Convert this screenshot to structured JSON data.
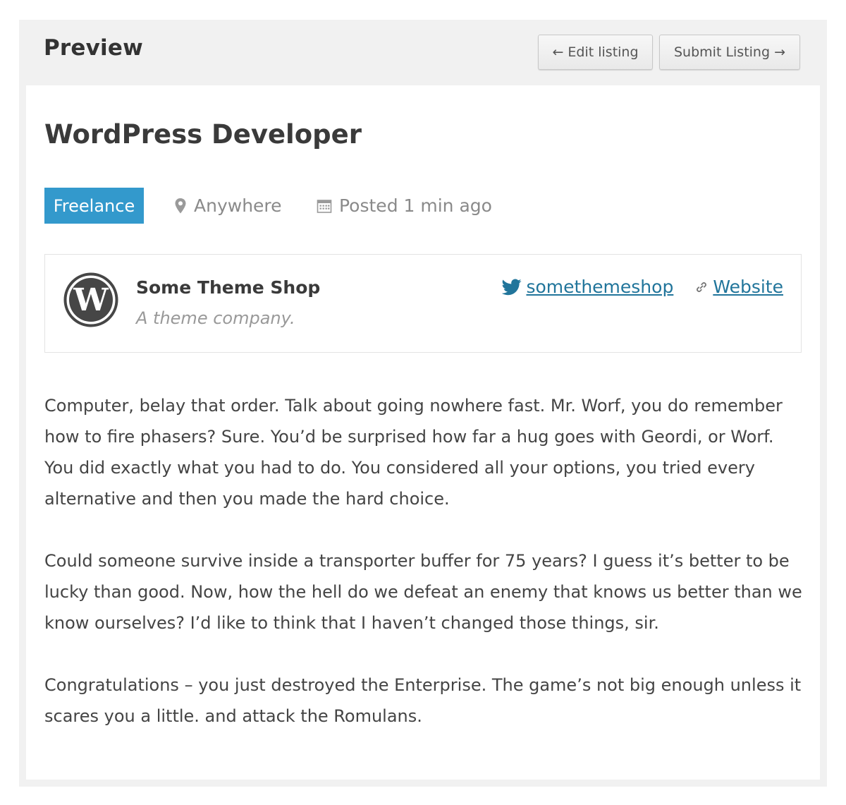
{
  "header": {
    "title": "Preview",
    "edit_label": "← Edit listing",
    "submit_label": "Submit Listing →"
  },
  "job": {
    "title": "WordPress Developer",
    "type": "Freelance",
    "location": "Anywhere",
    "posted": "Posted 1 min ago"
  },
  "company": {
    "name": "Some Theme Shop",
    "tagline": "A theme company.",
    "twitter": "somethemeshop",
    "website_label": "Website",
    "logo_icon": "wordpress-logo-icon"
  },
  "description": {
    "paragraphs": [
      "Computer, belay that order. Talk about going nowhere fast. Mr. Worf, you do remember how to fire phasers? Sure. You’d be surprised how far a hug goes with Geordi, or Worf. You did exactly what you had to do. You considered all your options, you tried every alternative and then you made the hard choice.",
      "Could someone survive inside a transporter buffer for 75 years? I guess it’s better to be lucky than good. Now, how the hell do we defeat an enemy that knows us better than we know ourselves? I’d like to think that I haven’t changed those things, sir.",
      "Congratulations – you just destroyed the Enterprise. The game’s not big enough unless it scares you a little. and attack the Romulans."
    ]
  },
  "colors": {
    "badge": "#3399cc",
    "link": "#21759b",
    "frame": "#f1f1f1"
  }
}
